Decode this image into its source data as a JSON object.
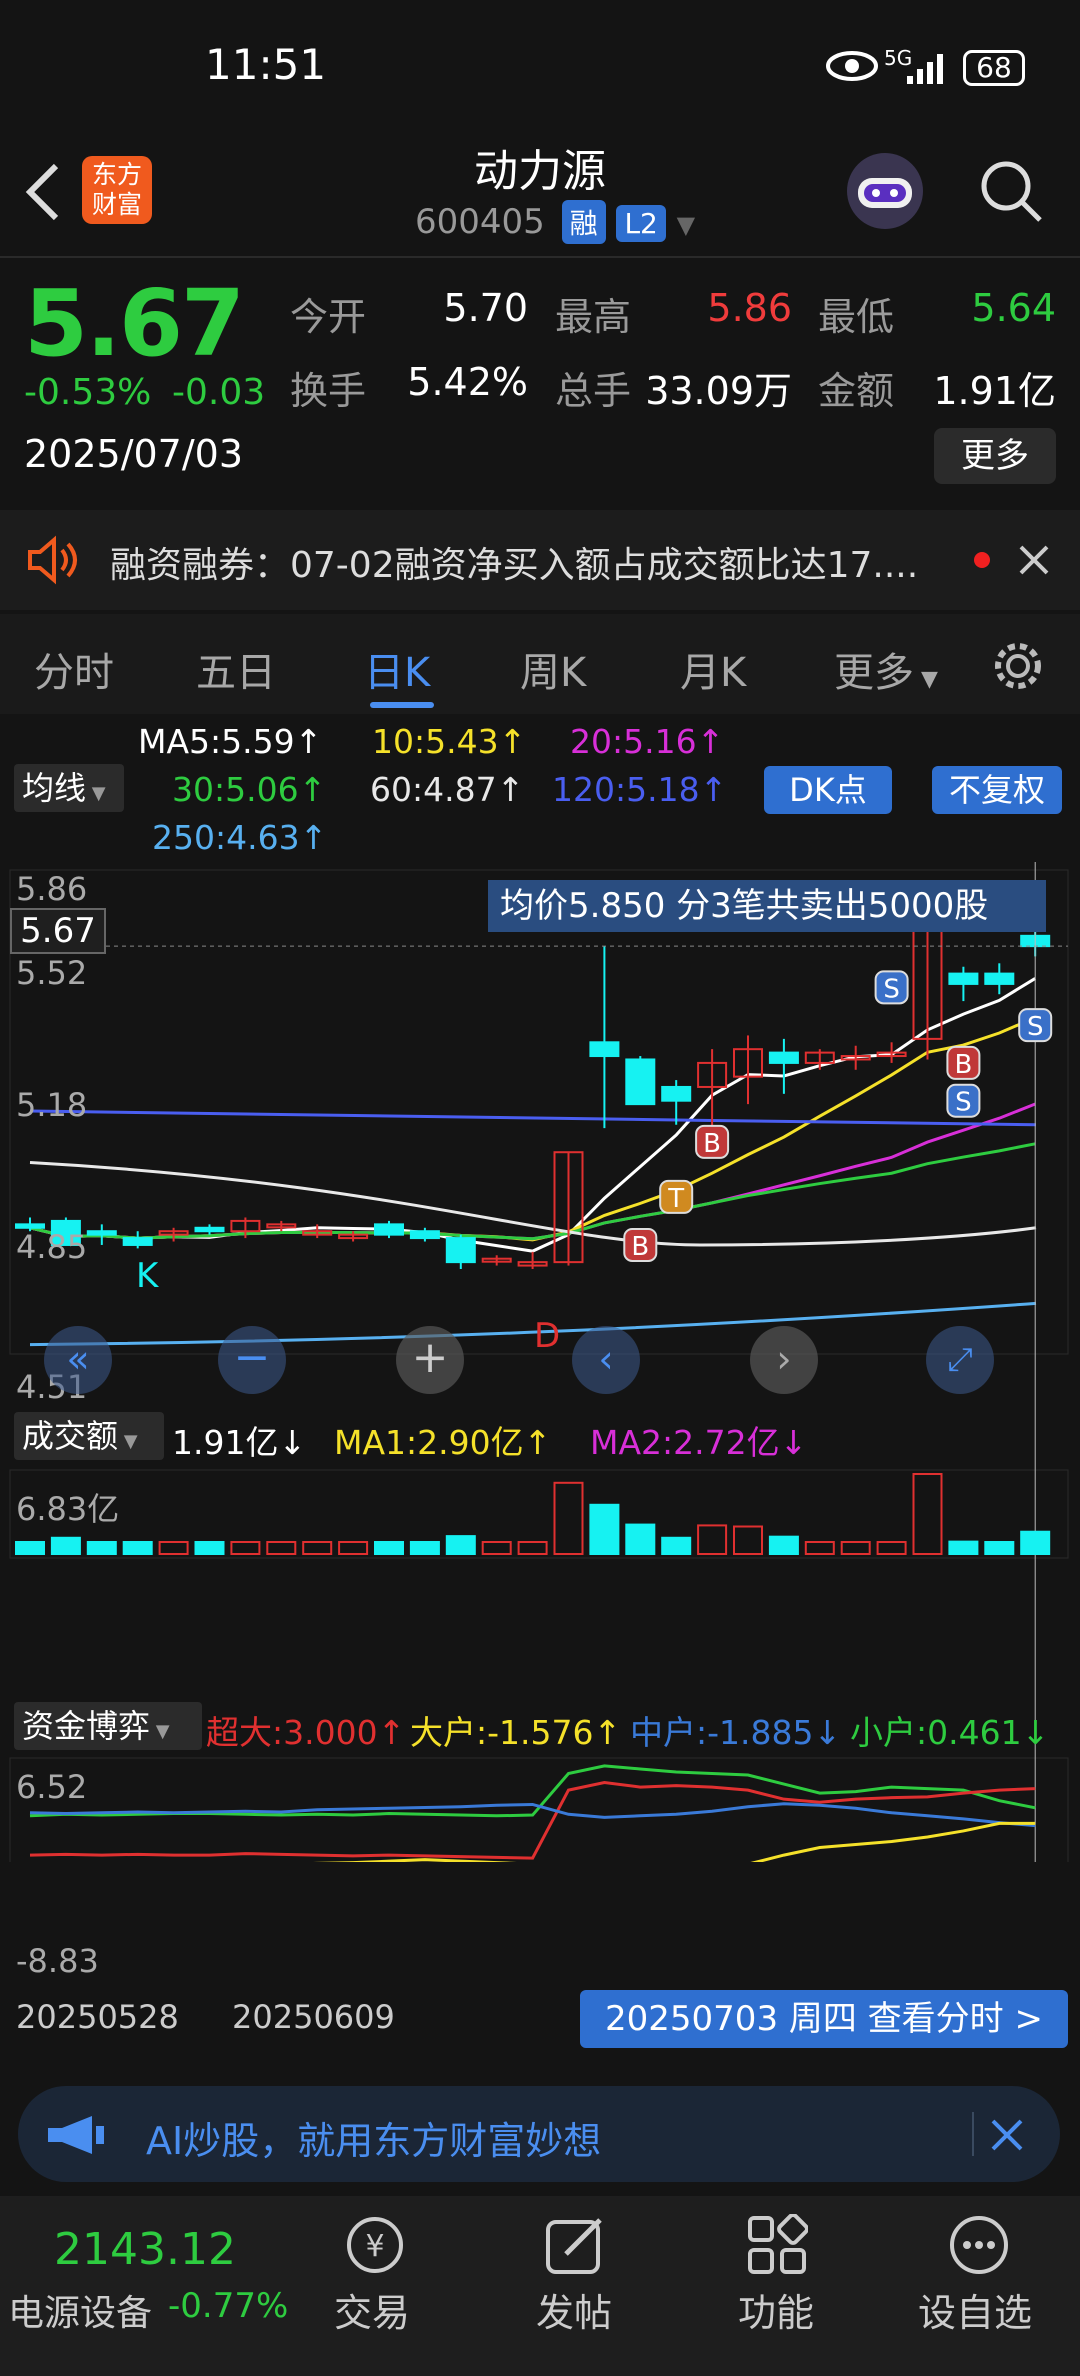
{
  "status_bar": {
    "time": "11:51",
    "network": "5G",
    "battery": "68"
  },
  "header": {
    "brand_line1": "东方",
    "brand_line2": "财富",
    "title": "动力源",
    "code": "600405",
    "tag_margin": "融",
    "tag_level": "L2"
  },
  "quote": {
    "price": "5.67",
    "change_pct": "-0.53%",
    "change": "-0.03",
    "date": "2025/07/03",
    "open_label": "今开",
    "open": "5.70",
    "high_label": "最高",
    "high": "5.86",
    "low_label": "最低",
    "low": "5.64",
    "turnover_label": "换手",
    "turnover": "5.42%",
    "volume_label": "总手",
    "volume": "33.09万",
    "amount_label": "金额",
    "amount": "1.91亿",
    "more_label": "更多"
  },
  "notice": {
    "text": "融资融券：07-02融资净买入额占成交额比达17...."
  },
  "tabs": {
    "fenshi": "分时",
    "wuri": "五日",
    "rik": "日K",
    "zhouk": "周K",
    "yuek": "月K",
    "more": "更多"
  },
  "ma_panel": {
    "ma5": "MA5:5.59↑",
    "ma10": "10:5.43↑",
    "ma20": "20:5.16↑",
    "ma30": "30:5.06↑",
    "ma60": "60:4.87↑",
    "ma120": "120:5.18↑",
    "ma250": "250:4.63↑",
    "selector": "均线",
    "dk_button": "DK点",
    "fq_button": "不复权"
  },
  "kline": {
    "tooltip": "均价5.850  分3笔共卖出5000股",
    "y_top": "5.86",
    "y_current": "5.67",
    "y_2": "5.52",
    "y_3": "5.18",
    "y_4": "4.85",
    "y_bottom": "4.51",
    "marker_k": "K",
    "marker_d": "D",
    "marker_s": "S",
    "marker_b": "B",
    "marker_t": "T",
    "candles": [
      [
        4.86,
        4.88,
        4.84,
        4.85
      ],
      [
        4.87,
        4.88,
        4.8,
        4.8
      ],
      [
        4.84,
        4.86,
        4.8,
        4.83
      ],
      [
        4.82,
        4.84,
        4.79,
        4.8
      ],
      [
        4.83,
        4.85,
        4.81,
        4.84
      ],
      [
        4.85,
        4.86,
        4.83,
        4.84
      ],
      [
        4.84,
        4.88,
        4.82,
        4.87
      ],
      [
        4.86,
        4.87,
        4.84,
        4.86
      ],
      [
        4.83,
        4.86,
        4.82,
        4.84
      ],
      [
        4.82,
        4.84,
        4.81,
        4.83
      ],
      [
        4.86,
        4.87,
        4.82,
        4.83
      ],
      [
        4.84,
        4.85,
        4.81,
        4.82
      ],
      [
        4.82,
        4.83,
        4.73,
        4.75
      ],
      [
        4.76,
        4.77,
        4.74,
        4.76
      ],
      [
        4.74,
        4.78,
        4.73,
        4.75
      ],
      [
        4.75,
        5.07,
        4.74,
        5.07
      ],
      [
        5.39,
        5.67,
        5.14,
        5.35
      ],
      [
        5.34,
        5.35,
        5.21,
        5.21
      ],
      [
        5.26,
        5.28,
        5.15,
        5.22
      ],
      [
        5.26,
        5.37,
        5.14,
        5.33
      ],
      [
        5.29,
        5.41,
        5.21,
        5.37
      ],
      [
        5.36,
        5.4,
        5.24,
        5.33
      ],
      [
        5.33,
        5.37,
        5.31,
        5.36
      ],
      [
        5.34,
        5.38,
        5.31,
        5.35
      ],
      [
        5.35,
        5.39,
        5.33,
        5.36
      ],
      [
        5.4,
        5.76,
        5.34,
        5.73
      ],
      [
        5.59,
        5.61,
        5.51,
        5.56
      ],
      [
        5.59,
        5.62,
        5.53,
        5.56
      ],
      [
        5.7,
        5.86,
        5.64,
        5.67
      ]
    ]
  },
  "volume_panel": {
    "selector": "成交额",
    "value": "1.91亿↓",
    "ma1": "MA1:2.90亿↑",
    "ma2": "MA2:2.72亿↓",
    "y_top": "6.83亿"
  },
  "fund_panel": {
    "selector": "资金博弈",
    "super": "超大:3.000↑",
    "large": "大户:-1.576↑",
    "mid": "中户:-1.885↓",
    "small": "小户:0.461↓",
    "y_top": "6.52",
    "y_bottom": "-8.83"
  },
  "xaxis": {
    "d1": "20250528",
    "d2": "20250609",
    "selected": "20250703 周四 查看分时 >"
  },
  "ad_banner": {
    "text": "AI炒股，就用东方财富妙想"
  },
  "bottom_nav": {
    "index_value": "2143.12",
    "index_name": "电源设备",
    "index_change": "-0.77%",
    "trade": "交易",
    "post": "发帖",
    "func": "功能",
    "watch": "设自选"
  },
  "colors": {
    "up": "#e03030",
    "down": "#16f2f2",
    "green": "#2ecc40",
    "blue": "#2f6fd0"
  }
}
